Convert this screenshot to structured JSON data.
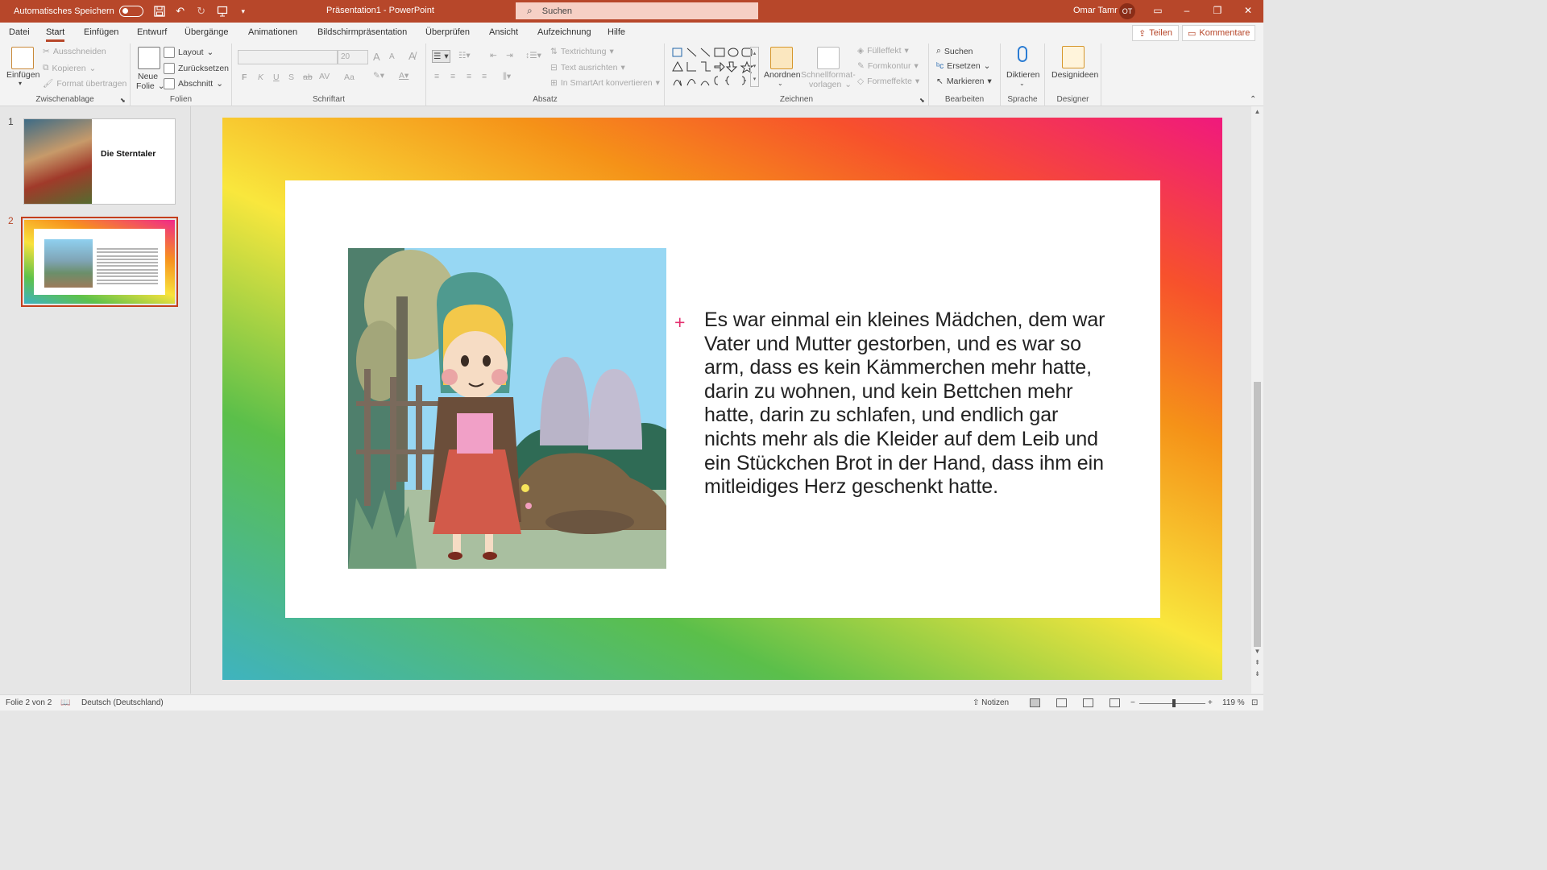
{
  "titlebar": {
    "autosave_label": "Automatisches Speichern",
    "doc_title": "Präsentation1  -  PowerPoint",
    "search_label": "Suchen",
    "user_name": "Omar Tamr",
    "user_initials": "OT",
    "accent": "#b7472a"
  },
  "menu": {
    "tabs": [
      "Datei",
      "Start",
      "Einfügen",
      "Entwurf",
      "Übergänge",
      "Animationen",
      "Bildschirmpräsentation",
      "Überprüfen",
      "Ansicht",
      "Aufzeichnung",
      "Hilfe"
    ],
    "active_tab": "Start",
    "share_label": "Teilen",
    "comments_label": "Kommentare"
  },
  "ribbon": {
    "clipboard": {
      "label": "Zwischenablage",
      "paste": "Einfügen",
      "cut": "Ausschneiden",
      "copy": "Kopieren",
      "format_painter": "Format übertragen"
    },
    "slides": {
      "label": "Folien",
      "new_slide_1": "Neue",
      "new_slide_2": "Folie",
      "layout": "Layout",
      "reset": "Zurücksetzen",
      "section": "Abschnitt"
    },
    "font": {
      "label": "Schriftart",
      "font_size": "20",
      "bold": "F",
      "italic": "K",
      "underline": "U",
      "shadow": "S",
      "strike": "ab",
      "spacing": "AV",
      "case": "Aa",
      "grow": "A",
      "shrink": "A"
    },
    "paragraph": {
      "label": "Absatz",
      "text_direction": "Textrichtung",
      "align_text": "Text ausrichten",
      "smartart": "In SmartArt konvertieren"
    },
    "drawing": {
      "label": "Zeichnen",
      "arrange": "Anordnen",
      "quick_styles_1": "Schnellformat-",
      "quick_styles_2": "vorlagen",
      "fill": "Fülleffekt",
      "outline": "Formkontur",
      "effects": "Formeffekte"
    },
    "editing": {
      "label": "Bearbeiten",
      "find": "Suchen",
      "replace": "Ersetzen",
      "select": "Markieren"
    },
    "voice": {
      "label": "Sprache",
      "dictate": "Diktieren"
    },
    "designer": {
      "label": "Designer",
      "ideas": "Designideen"
    }
  },
  "slides_panel": {
    "slides": [
      {
        "number": "1",
        "title": "Die Sterntaler"
      },
      {
        "number": "2"
      }
    ],
    "selected": 2
  },
  "slide": {
    "body_text": "Es war einmal ein kleines Mädchen, dem war Vater und Mutter gestorben, und es war so arm, dass es kein Kämmerchen mehr hatte, darin zu wohnen, und kein Bettchen mehr hatte, darin zu schlafen, und endlich gar nichts mehr als die Kleider auf dem Leib und ein Stückchen Brot in der Hand, dass ihm ein mitleidiges Herz geschenkt hatte.",
    "bullet": "+",
    "bullet_color": "#e4306f"
  },
  "statusbar": {
    "slide_info": "Folie 2 von 2",
    "language": "Deutsch (Deutschland)",
    "notes": "Notizen",
    "zoom": "119 %",
    "zoom_minus": "−",
    "zoom_plus": "+"
  }
}
